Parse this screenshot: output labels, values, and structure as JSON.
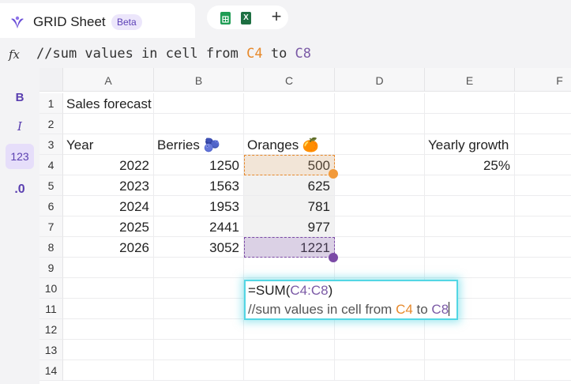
{
  "app": {
    "title": "GRID Sheet",
    "badge": "Beta"
  },
  "colors": {
    "accent": "#5b3fb6",
    "orange": "#e7892b",
    "purple": "#7b4aa6",
    "editor_glow": "#53d6e4"
  },
  "toolbar_icons": [
    "google-sheets-icon",
    "excel-icon",
    "add-icon"
  ],
  "formula_bar": {
    "fx": "fx",
    "text_pre": "//sum values in cell from ",
    "ref_start": "C4",
    "text_mid": " to ",
    "ref_end": "C8"
  },
  "format_toolbar": {
    "bold": "B",
    "italic": "I",
    "number_format": "123",
    "decimal": ".0"
  },
  "columns": [
    "A",
    "B",
    "C",
    "D",
    "E",
    "F"
  ],
  "rows": [
    "1",
    "2",
    "3",
    "4",
    "5",
    "6",
    "7",
    "8",
    "9",
    "10",
    "11",
    "12",
    "13",
    "14"
  ],
  "cells": {
    "A1": "Sales forecast",
    "A3": "Year",
    "B3": "Berries 🫐",
    "C3": "Oranges 🍊",
    "E3": "Yearly growth",
    "A4": "2022",
    "B4": "1250",
    "C4": "500",
    "E4": "25%",
    "A5": "2023",
    "B5": "1563",
    "C5": "625",
    "A6": "2024",
    "B6": "1953",
    "C6": "781",
    "A7": "2025",
    "B7": "2441",
    "C7": "977",
    "A8": "2026",
    "B8": "3052",
    "C8": "1221"
  },
  "editor": {
    "line1_pre": "=SUM(",
    "line1_ref": "C4:C8",
    "line1_post": ")",
    "line2_pre": "//sum values in cell from ",
    "line2_ref_start": "C4",
    "line2_mid": " to ",
    "line2_ref_end": "C8"
  }
}
